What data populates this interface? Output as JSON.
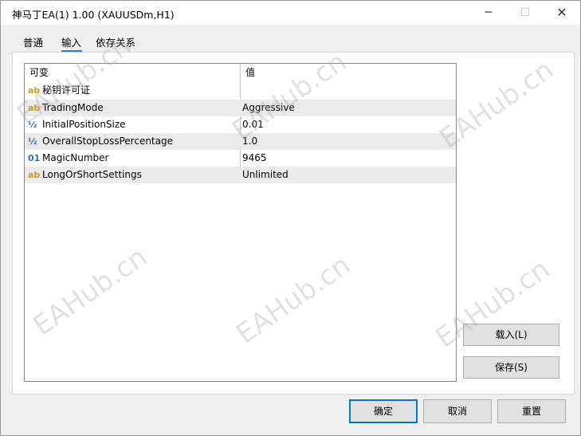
{
  "window": {
    "title": "神马丁EA(1) 1.00 (XAUUSDm,H1)",
    "minimize_glyph": "─",
    "maximize_glyph": "☐",
    "close_glyph": "✕"
  },
  "tabs": [
    {
      "label": "普通",
      "active": false
    },
    {
      "label": "输入",
      "active": true
    },
    {
      "label": "依存关系",
      "active": false
    }
  ],
  "grid": {
    "headers": {
      "name": "可变",
      "value": "值"
    },
    "rows": [
      {
        "icon": "ab",
        "icon_name": "string-type-icon",
        "name": "秘钥许可证",
        "value": ""
      },
      {
        "icon": "ab",
        "icon_name": "string-type-icon",
        "name": "TradingMode",
        "value": "Aggressive"
      },
      {
        "icon": "½",
        "icon_name": "double-type-icon",
        "name": "InitialPositionSize",
        "value": "0.01"
      },
      {
        "icon": "½",
        "icon_name": "double-type-icon",
        "name": "OverallStopLossPercentage",
        "value": "1.0"
      },
      {
        "icon": "01",
        "icon_name": "integer-type-icon",
        "name": "MagicNumber",
        "value": "9465"
      },
      {
        "icon": "ab",
        "icon_name": "string-type-icon",
        "name": "LongOrShortSettings",
        "value": "Unlimited"
      }
    ]
  },
  "side_buttons": {
    "load": "载入(L)",
    "save": "保存(S)"
  },
  "footer_buttons": {
    "ok": "确定",
    "cancel": "取消",
    "reset": "重置"
  },
  "watermark": "EAHub.cn",
  "colors": {
    "accent": "#0078d7",
    "tab_underline": "#2f7dd1",
    "string_icon": "#c89a24",
    "number_icon": "#2c6fb8"
  }
}
